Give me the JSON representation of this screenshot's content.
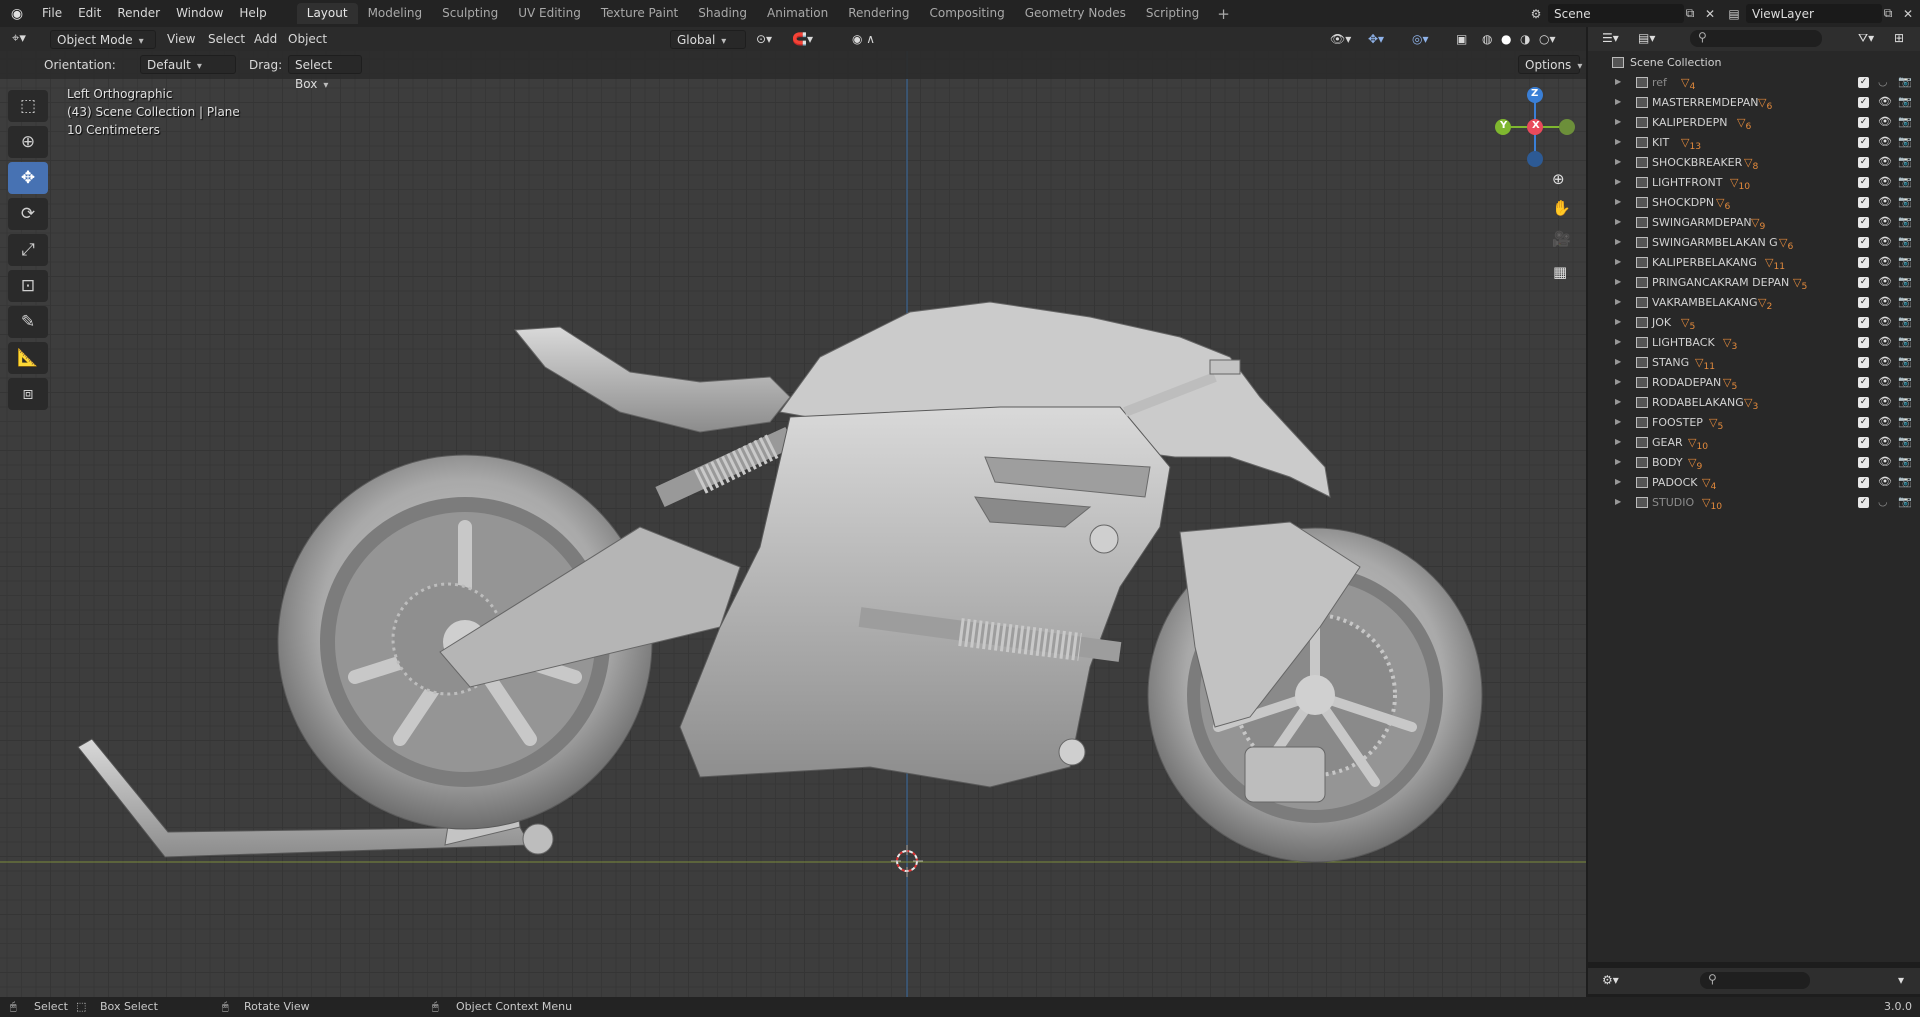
{
  "menu": [
    "File",
    "Edit",
    "Render",
    "Window",
    "Help"
  ],
  "workspace_tabs": [
    {
      "label": "Layout",
      "active": true
    },
    {
      "label": "Modeling"
    },
    {
      "label": "Sculpting"
    },
    {
      "label": "UV Editing"
    },
    {
      "label": "Texture Paint"
    },
    {
      "label": "Shading"
    },
    {
      "label": "Animation"
    },
    {
      "label": "Rendering"
    },
    {
      "label": "Compositing"
    },
    {
      "label": "Geometry Nodes"
    },
    {
      "label": "Scripting"
    }
  ],
  "scene": {
    "label": "Scene"
  },
  "view_layer": {
    "label": "ViewLayer"
  },
  "viewport_header": {
    "mode": "Object Mode",
    "menus": [
      "View",
      "Select",
      "Add",
      "Object"
    ],
    "transform_orientation": "Global",
    "options": "Options"
  },
  "tool_settings": {
    "orientation_label": "Orientation:",
    "orientation_value": "Default",
    "drag_label": "Drag:",
    "drag_value": "Select Box"
  },
  "viewport_info": {
    "view": "Left Orthographic",
    "collection": "(43) Scene Collection | Plane",
    "scale": "10 Centimeters"
  },
  "gizmo": {
    "x": "X",
    "y": "Y",
    "z": "Z",
    "x_color": "#e94a5c",
    "y_color": "#7fb72f",
    "z_color": "#3a7fd6"
  },
  "outliner": {
    "root": "Scene Collection",
    "items": [
      {
        "name": "ref",
        "badge": "4",
        "dim": true
      },
      {
        "name": "MASTERREMDEPAN",
        "badge": "6"
      },
      {
        "name": "KALIPERDEPN",
        "badge": "6"
      },
      {
        "name": "KIT",
        "badge": "13"
      },
      {
        "name": "SHOCKBREAKER",
        "badge": "8"
      },
      {
        "name": "LIGHTFRONT",
        "badge": "10"
      },
      {
        "name": "SHOCKDPN",
        "badge": "6"
      },
      {
        "name": "SWINGARMDEPAN",
        "badge": "9"
      },
      {
        "name": "SWINGARMBELAKAN G",
        "badge": "6"
      },
      {
        "name": "KALIPERBELAKANG",
        "badge": "11"
      },
      {
        "name": "PRINGANCAKRAM DEPAN",
        "badge": "5"
      },
      {
        "name": "VAKRAMBELAKANG",
        "badge": "2"
      },
      {
        "name": "JOK",
        "badge": "5"
      },
      {
        "name": "LIGHTBACK",
        "badge": "3"
      },
      {
        "name": "STANG",
        "badge": "11"
      },
      {
        "name": "RODADEPAN",
        "badge": "5"
      },
      {
        "name": "RODABELAKANG",
        "badge": "3"
      },
      {
        "name": "FOOSTEP",
        "badge": "5"
      },
      {
        "name": "GEAR",
        "badge": "10"
      },
      {
        "name": "BODY",
        "badge": "9"
      },
      {
        "name": "PADOCK",
        "badge": "4"
      },
      {
        "name": "STUDIO",
        "badge": "10",
        "dim": true
      }
    ]
  },
  "status": {
    "select": "Select",
    "box_select": "Box Select",
    "rotate_view": "Rotate View",
    "context_menu": "Object Context Menu",
    "version": "3.0.0"
  },
  "colors": {
    "accent": "#4772b3",
    "badge": "#e38a3c"
  }
}
